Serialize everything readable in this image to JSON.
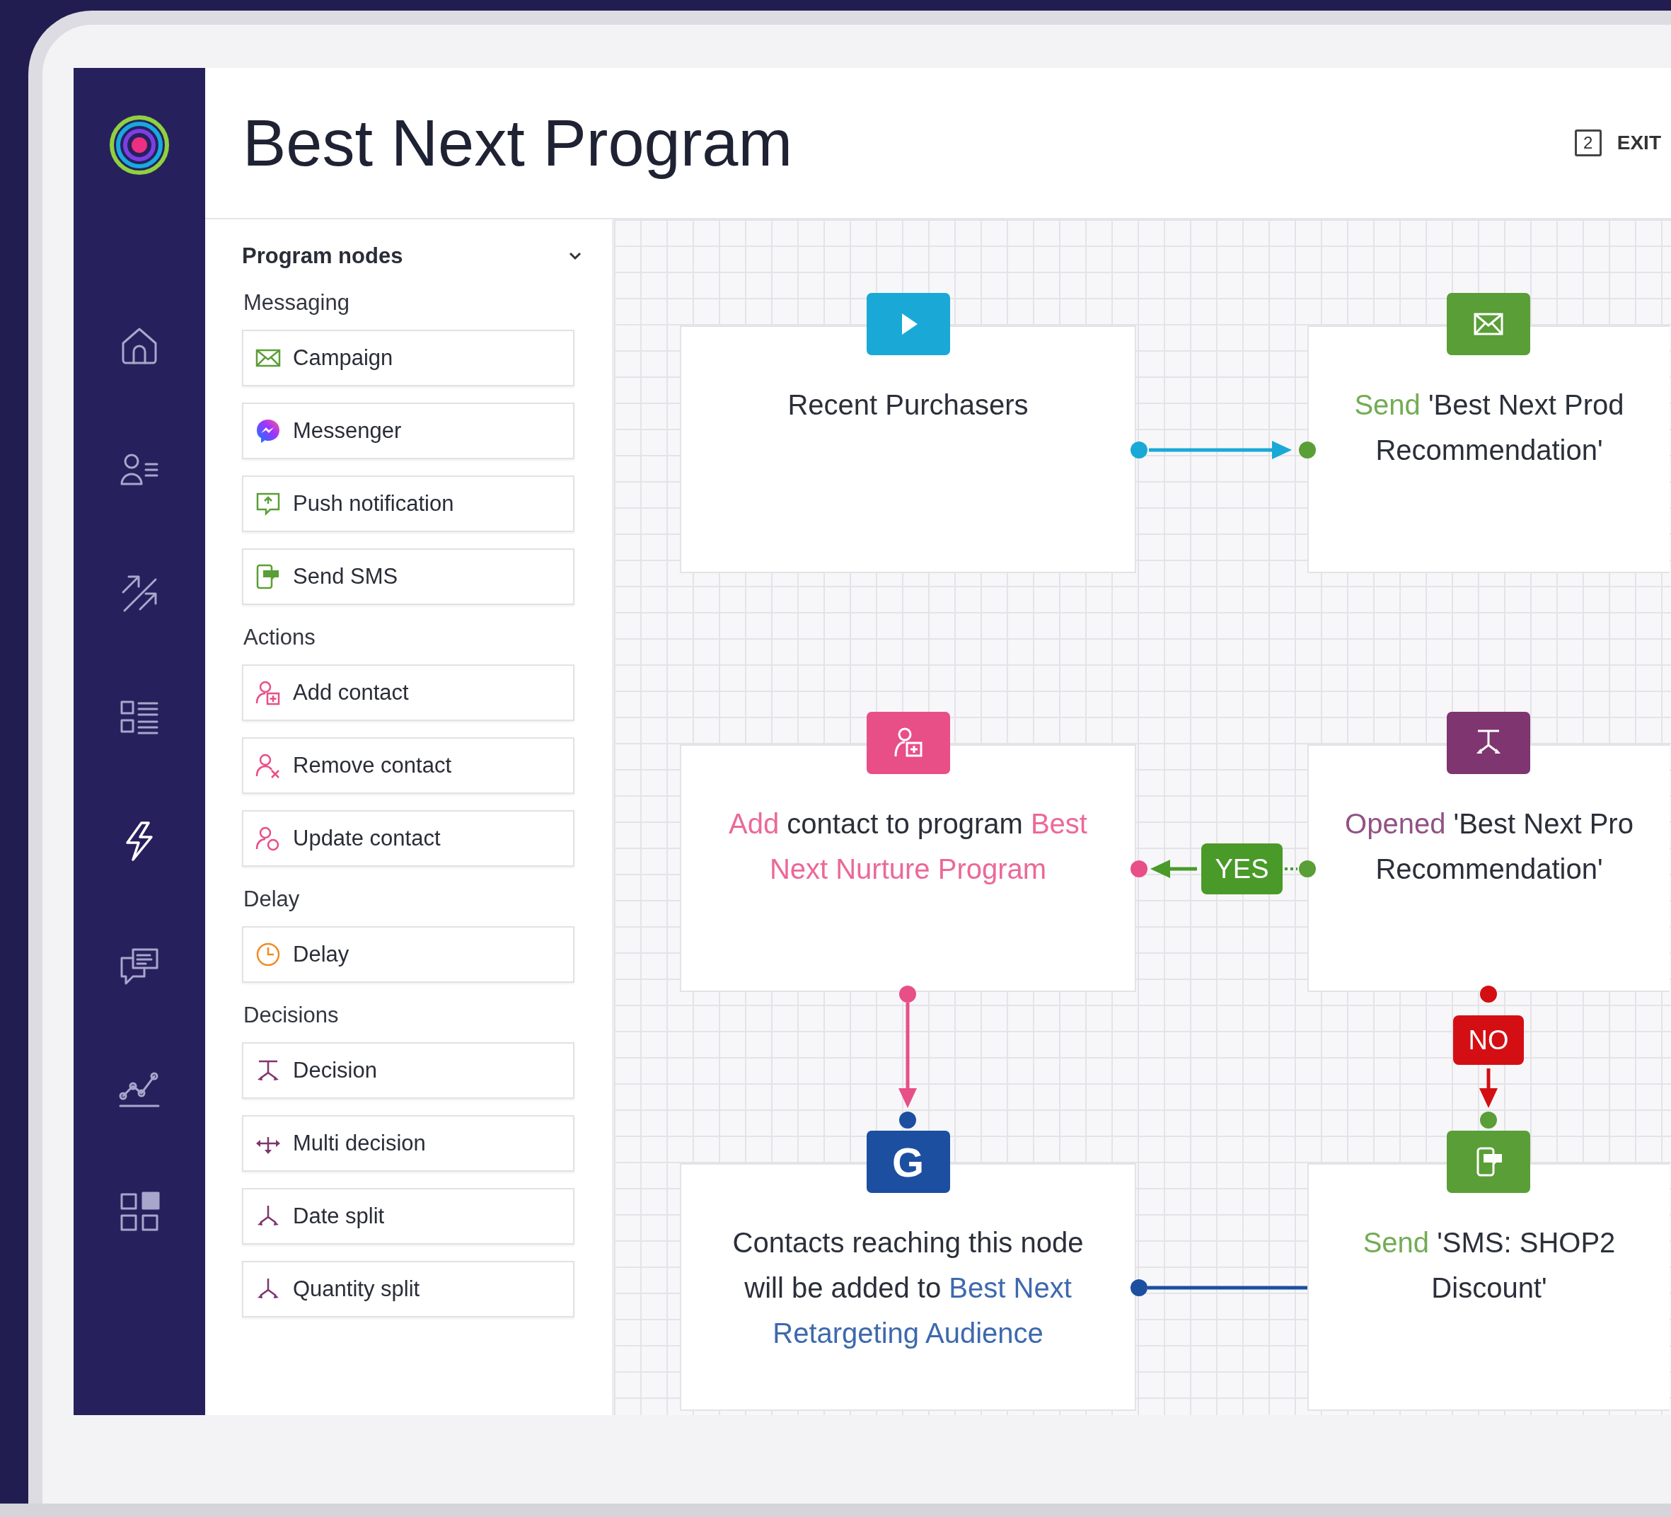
{
  "app": {
    "title": "Best Next Program",
    "exit_key": "2",
    "exit_label": "EXIT"
  },
  "nav": [
    {
      "kind": "home",
      "selected": false
    },
    {
      "kind": "contacts",
      "selected": false
    },
    {
      "kind": "arrows",
      "selected": false
    },
    {
      "kind": "list",
      "selected": false
    },
    {
      "kind": "bolt",
      "selected": true
    },
    {
      "kind": "chat",
      "selected": false
    },
    {
      "kind": "chart",
      "selected": false
    },
    {
      "kind": "grid",
      "selected": false
    }
  ],
  "palette": {
    "title": "Program nodes",
    "expanded": true,
    "groups": [
      {
        "label": "Messaging",
        "items": [
          {
            "label": "Campaign",
            "kind": "envelope"
          },
          {
            "label": "Messenger",
            "kind": "messenger"
          },
          {
            "label": "Push notification",
            "kind": "push"
          },
          {
            "label": "Send SMS",
            "kind": "sms"
          }
        ]
      },
      {
        "label": "Actions",
        "items": [
          {
            "label": "Add contact",
            "kind": "add-contact"
          },
          {
            "label": "Remove contact",
            "kind": "remove-contact"
          },
          {
            "label": "Update contact",
            "kind": "update-contact"
          }
        ]
      },
      {
        "label": "Delay",
        "items": [
          {
            "label": "Delay",
            "kind": "clock"
          }
        ]
      },
      {
        "label": "Decisions",
        "items": [
          {
            "label": "Decision",
            "kind": "decision"
          },
          {
            "label": "Multi decision",
            "kind": "multi"
          },
          {
            "label": "Date split",
            "kind": "split"
          },
          {
            "label": "Quantity split",
            "kind": "split"
          }
        ]
      }
    ]
  },
  "canvas": {
    "nodes": [
      {
        "kind": "start",
        "color": "#1aa9d6",
        "lines": [
          [
            {
              "text": "Recent Purchasers",
              "kind": "plain"
            }
          ]
        ]
      },
      {
        "kind": "email",
        "color": "#5a9e37",
        "lines": [
          [
            {
              "text": "Send",
              "kind": "accent"
            },
            {
              "text": " 'Best Next Prod",
              "kind": "plain"
            }
          ],
          [
            {
              "text": "Recommendation'",
              "kind": "plain"
            }
          ]
        ]
      },
      {
        "kind": "add-contact",
        "color": "#e84f86",
        "lines": [
          [
            {
              "text": "Add",
              "kind": "accent"
            },
            {
              "text": " contact to program ",
              "kind": "plain"
            },
            {
              "text": "Best",
              "kind": "accent"
            }
          ],
          [
            {
              "text": "Next Nurture Program",
              "kind": "accent"
            }
          ]
        ]
      },
      {
        "kind": "decision",
        "color": "#7e3570",
        "lines": [
          [
            {
              "text": "Opened",
              "kind": "accent"
            },
            {
              "text": " 'Best Next Pro",
              "kind": "plain"
            }
          ],
          [
            {
              "text": "Recommendation'",
              "kind": "plain"
            }
          ]
        ]
      },
      {
        "kind": "audience",
        "color": "#1c4fa0",
        "badge_text": "G",
        "lines": [
          [
            {
              "text": "Contacts reaching this node",
              "kind": "plain"
            }
          ],
          [
            {
              "text": "will be added to ",
              "kind": "plain"
            },
            {
              "text": "Best Next",
              "kind": "accent"
            }
          ],
          [
            {
              "text": "Retargeting Audience",
              "kind": "accent"
            }
          ]
        ]
      },
      {
        "kind": "sms",
        "color": "#5a9e37",
        "lines": [
          [
            {
              "text": "Send",
              "kind": "accent"
            },
            {
              "text": " 'SMS: SHOP2",
              "kind": "plain"
            }
          ],
          [
            {
              "text": "Discount'",
              "kind": "plain"
            }
          ]
        ]
      }
    ],
    "branches": [
      {
        "kind": "yes",
        "label": "YES"
      },
      {
        "kind": "no",
        "label": "NO"
      }
    ]
  }
}
